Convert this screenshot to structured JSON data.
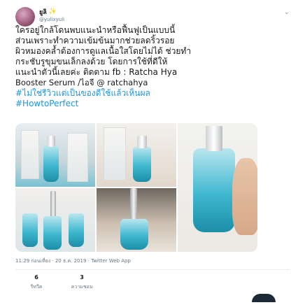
{
  "author": {
    "name": "ยูลิ",
    "emoji": "✨",
    "handle": "@yulixyuli",
    "avatar_icon": "avatar-icon"
  },
  "tweet": {
    "lines": [
      "ใครอยู่ใกล้โดนพบแนะนำหรือฟื้นฟูเป็นแบบนี้",
      "ส่วนเพราะทำความเข้มข้นมากช่วยลดริ้วรอย",
      "ผิวหมองคล้ำต้องการดูแลเนื้อใสโดยไม่ได้ ช่วยทำ",
      "กระชับรูขุมขนเล็กลงด้วย โดยการใช้ที่ดีให้",
      "แนะนำตัวนี้เลยค่ะ ติดตาม fb : Ratcha Hya",
      "Booster Serum /ไอจี @ ratchahya",
      "#ไม่ใช่รีวิวแต่เป็นของดีใช้แล้วเห็นผล",
      "#HowtoPerfect"
    ],
    "hashtag_color": "#1b95e0"
  },
  "timestamp": "11:29 ก่อนเที่ยง · 20 ธ.ค. 2019 · Twitter Web App",
  "stats": [
    {
      "count": "6",
      "label": "รีทวีต"
    },
    {
      "count": "3",
      "label": "ความชอบ"
    }
  ],
  "colors": {
    "text": "#14171a",
    "muted": "#657786",
    "accent": "#1b95e0"
  }
}
